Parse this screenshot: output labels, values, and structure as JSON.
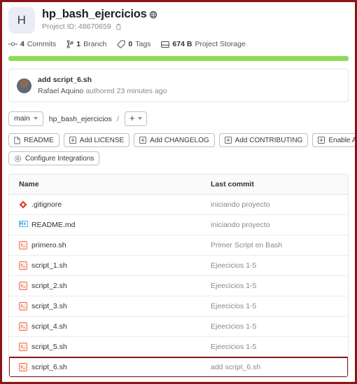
{
  "project": {
    "avatar_letter": "H",
    "name": "hp_bash_ejercicios",
    "visibility_icon": "globe-icon",
    "project_id_label": "Project ID: 48670659",
    "copy_icon": "copy-icon"
  },
  "stats": [
    {
      "icon": "commit-icon",
      "value": "4",
      "label": "Commits"
    },
    {
      "icon": "branch-icon",
      "value": "1",
      "label": "Branch"
    },
    {
      "icon": "tag-icon",
      "value": "0",
      "label": "Tags"
    },
    {
      "icon": "storage-icon",
      "value": "674 B",
      "label": "Project Storage"
    }
  ],
  "language_bar": {
    "color": "#8cdb55",
    "percent": 100
  },
  "last_commit": {
    "message": "add script_6.sh",
    "author": "Rafael Aquino",
    "meta": "authored 23 minutes ago",
    "avatar": "user-avatar"
  },
  "ref_row": {
    "branch": "main",
    "breadcrumb": "hp_bash_ejercicios",
    "separator": "/",
    "add_label": "+"
  },
  "actions": [
    {
      "icon": "document-icon",
      "label": "README"
    },
    {
      "icon": "plus-square-icon",
      "label": "Add LICENSE"
    },
    {
      "icon": "plus-square-icon",
      "label": "Add CHANGELOG"
    },
    {
      "icon": "plus-square-icon",
      "label": "Add CONTRIBUTING"
    },
    {
      "icon": "plus-square-icon",
      "label": "Enable Auto DevOps"
    },
    {
      "icon": "gear-icon",
      "label": "Configure Integrations"
    }
  ],
  "file_table": {
    "columns": {
      "name": "Name",
      "last_commit": "Last commit"
    },
    "rows": [
      {
        "icon": "git-icon",
        "name": ".gitignore",
        "last_commit": "iniciando proyecto",
        "highlighted": false
      },
      {
        "icon": "markdown-icon",
        "name": "README.md",
        "last_commit": "iniciando proyecto",
        "highlighted": false
      },
      {
        "icon": "shell-icon",
        "name": "primero.sh",
        "last_commit": "Primer Script en Bash",
        "highlighted": false
      },
      {
        "icon": "shell-icon",
        "name": "script_1.sh",
        "last_commit": "Ejeecicios 1-5",
        "highlighted": false
      },
      {
        "icon": "shell-icon",
        "name": "script_2.sh",
        "last_commit": "Ejeecicios 1-5",
        "highlighted": false
      },
      {
        "icon": "shell-icon",
        "name": "script_3.sh",
        "last_commit": "Ejeecicios 1-5",
        "highlighted": false
      },
      {
        "icon": "shell-icon",
        "name": "script_4.sh",
        "last_commit": "Ejeecicios 1-5",
        "highlighted": false
      },
      {
        "icon": "shell-icon",
        "name": "script_5.sh",
        "last_commit": "Ejeecicios 1-5",
        "highlighted": false
      },
      {
        "icon": "shell-icon",
        "name": "script_6.sh",
        "last_commit": "add script_6.sh",
        "highlighted": true
      }
    ]
  },
  "annotation": {
    "border_color": "#8a1515"
  }
}
